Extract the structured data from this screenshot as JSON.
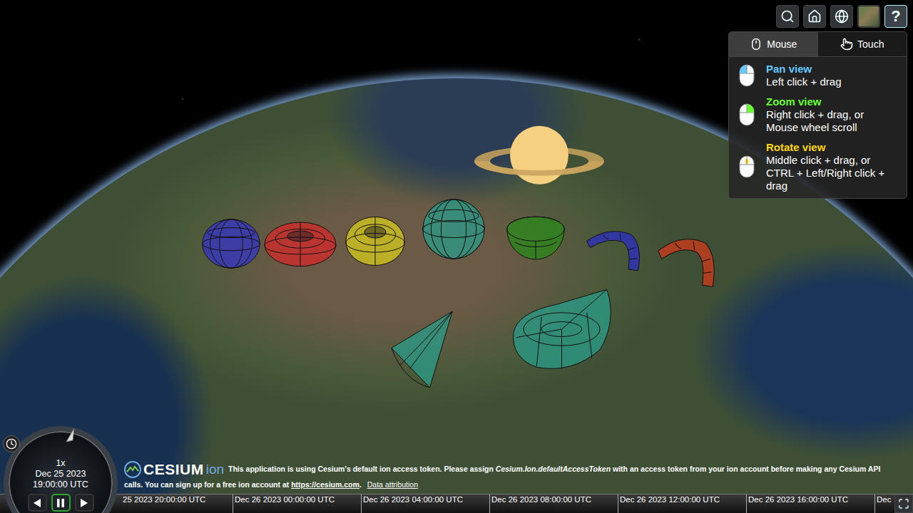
{
  "toolbar": {
    "help": {
      "label": "?",
      "expanded": true
    }
  },
  "help_panel": {
    "tabs": [
      {
        "label": "Mouse",
        "selected": true
      },
      {
        "label": "Touch",
        "selected": false
      }
    ],
    "items": [
      {
        "title": "Pan view",
        "lines": [
          "Left click + drag"
        ],
        "color": "#66c8ff"
      },
      {
        "title": "Zoom view",
        "lines": [
          "Right click + drag, or",
          "Mouse wheel scroll"
        ],
        "color": "#66ff33"
      },
      {
        "title": "Rotate view",
        "lines": [
          "Middle click + drag, or",
          "CTRL + Left/Right click +",
          "drag"
        ],
        "color": "#ffd800"
      }
    ]
  },
  "scene": {
    "shapes": [
      {
        "kind": "ellipsoid",
        "color": "#3434c8"
      },
      {
        "kind": "torus",
        "color": "#d42a2a"
      },
      {
        "kind": "torus",
        "color": "#d6cc1e"
      },
      {
        "kind": "ellipsoid",
        "color": "#2a9d8a"
      },
      {
        "kind": "bowl",
        "color": "#2a8a1a"
      },
      {
        "kind": "arc",
        "color": "#2c2cc4"
      },
      {
        "kind": "arc",
        "color": "#d03a1a"
      },
      {
        "kind": "cone",
        "color": "#2a9d8a"
      },
      {
        "kind": "wedge",
        "color": "#2a9d8a"
      },
      {
        "kind": "planet",
        "color": "#f5d080"
      }
    ]
  },
  "logo": {
    "name": "CESIUM",
    "suffix": "ion"
  },
  "credits": {
    "before": "This application is using Cesium's default ion access token. Please assign ",
    "code": "Cesium.Ion.defaultAccessToken",
    "after": " with an access token from your ion account before making any Cesium API calls. You can sign up for a free ion account at ",
    "link": "https://cesium.com",
    "end": ".",
    "attribution": "Data attribution"
  },
  "animation": {
    "speed": "1x",
    "date": "Dec 25 2023",
    "time": "19:00:00 UTC",
    "controls": [
      {
        "kind": "reverse",
        "selected": false
      },
      {
        "kind": "pause",
        "selected": true
      },
      {
        "kind": "play",
        "selected": false
      }
    ]
  },
  "timeline": {
    "labels": [
      "25 2023 20:00:00 UTC",
      "Dec 26 2023 00:00:00 UTC",
      "Dec 26 2023 04:00:00 UTC",
      "Dec 26 2023 08:00:00 UTC",
      "Dec 26 2023 12:00:00 UTC",
      "Dec 26 2023 16:00:00 UTC",
      "Dec"
    ]
  }
}
